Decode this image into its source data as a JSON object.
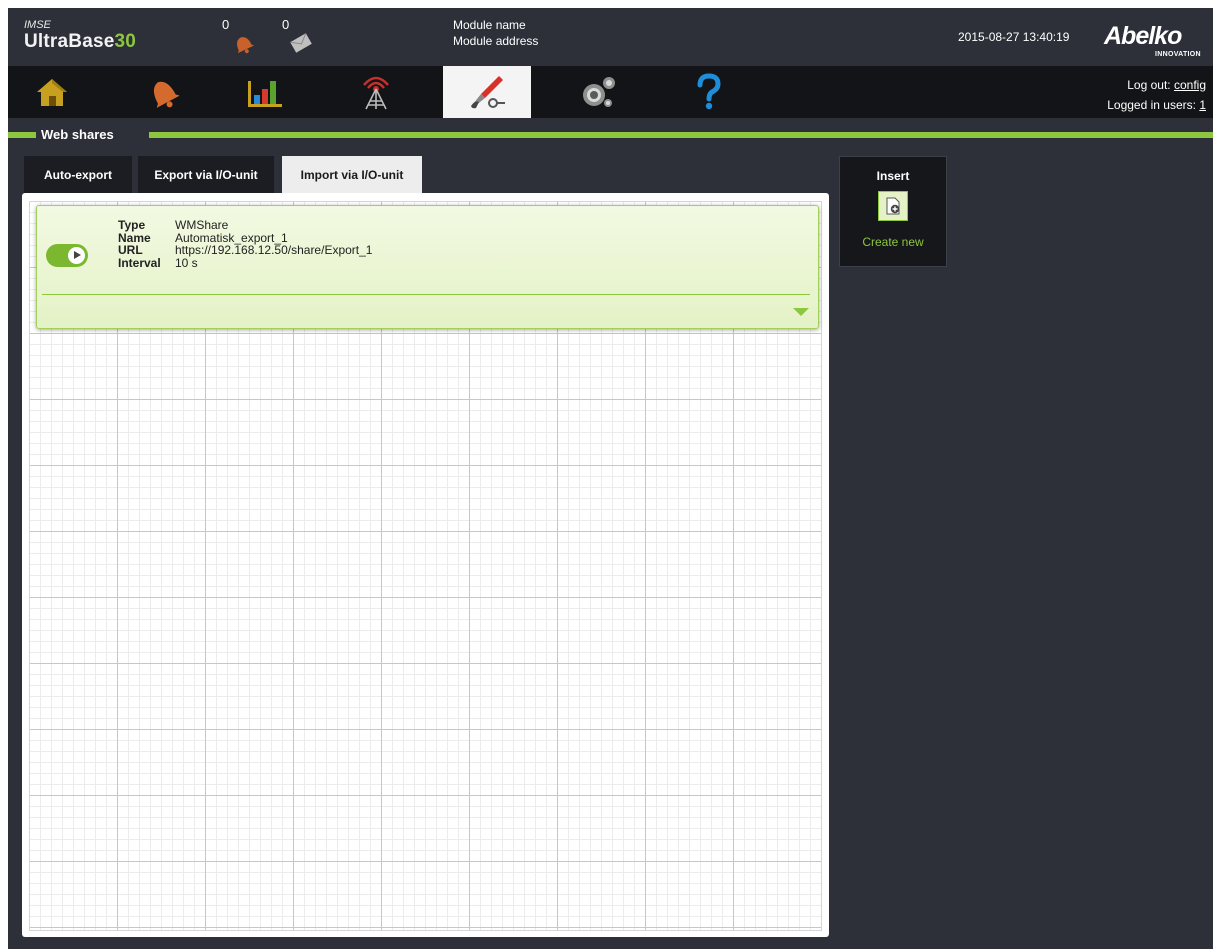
{
  "header": {
    "brand_small": "IMSE",
    "brand_name": "UltraBase",
    "brand_number": "30",
    "alarm_count": "0",
    "message_count": "0",
    "module_name": "Module name",
    "module_address": "Module address",
    "datetime": "2015-08-27 13:40:19",
    "logo": "Abelko",
    "logo_sub": "INNOVATION"
  },
  "nav": {
    "items": [
      {
        "name": "home",
        "icon": "house-icon"
      },
      {
        "name": "alarms",
        "icon": "bell-icon"
      },
      {
        "name": "charts",
        "icon": "bar-chart-icon"
      },
      {
        "name": "communication",
        "icon": "antenna-icon"
      },
      {
        "name": "tools",
        "icon": "tools-icon",
        "active": true
      },
      {
        "name": "settings",
        "icon": "gears-icon"
      },
      {
        "name": "help",
        "icon": "question-icon"
      }
    ],
    "logout_label": "Log out:",
    "logout_user": "config",
    "logged_in_label": "Logged in users:",
    "logged_in_count": "1"
  },
  "section": {
    "title": "Web shares"
  },
  "tabs": [
    {
      "label": "Auto-export",
      "active": false
    },
    {
      "label": "Export via I/O-unit",
      "active": false
    },
    {
      "label": "Import via I/O-unit",
      "active": true
    }
  ],
  "card": {
    "enabled": true,
    "labels": {
      "type": "Type",
      "name": "Name",
      "url": "URL",
      "interval": "Interval"
    },
    "values": {
      "type": "WMShare",
      "name": "Automatisk_export_1",
      "url": "https://192.168.12.50/share/Export_1",
      "interval": "10 s"
    }
  },
  "insert": {
    "title": "Insert",
    "create_label": "Create new",
    "icon": "document-add-icon"
  },
  "colors": {
    "accent": "#8dc63f",
    "background": "#2d3039",
    "nav_background": "#121417",
    "card_background": "#e4f2c6"
  }
}
